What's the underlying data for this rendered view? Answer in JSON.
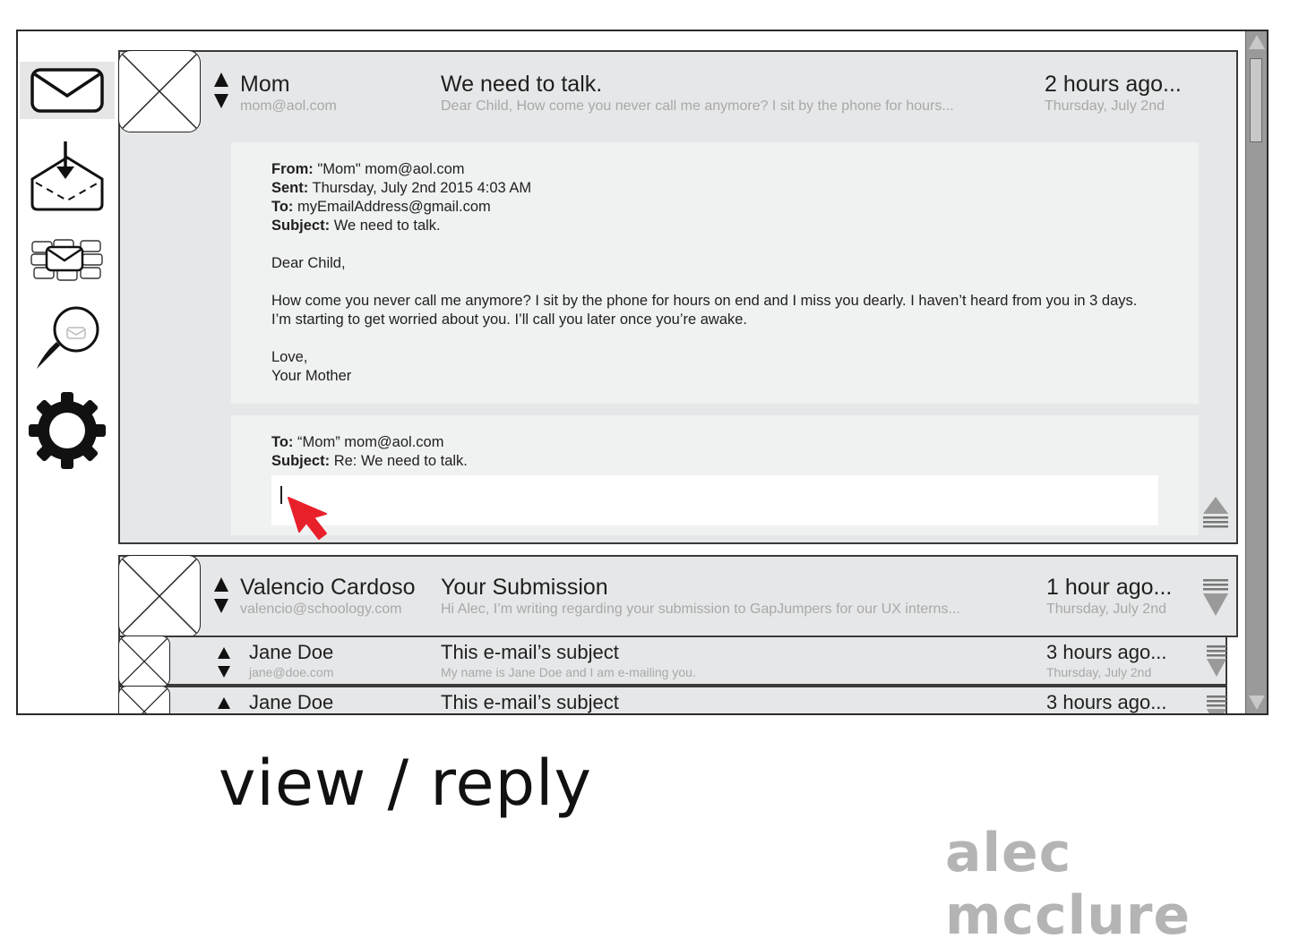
{
  "app": {
    "caption": "view / reply",
    "author": "alec mcclure"
  },
  "sidebar": {
    "items": [
      {
        "icon": "envelope-icon",
        "label": ""
      },
      {
        "icon": "inbox-download-icon",
        "label": ""
      },
      {
        "icon": "mail-stack-icon",
        "label": ""
      },
      {
        "icon": "search-icon",
        "label": ""
      },
      {
        "icon": "gear-icon",
        "label": ""
      }
    ]
  },
  "open_message": {
    "sender": "Mom",
    "email": "mom@aol.com",
    "subject": "We need to talk.",
    "preview": "Dear Child,  How come you never call me anymore?  I sit by the phone for hours...",
    "time": "2 hours ago...",
    "date": "Thursday, July 2nd",
    "headers": {
      "from_label": "From:",
      "from_value": "\"Mom\" mom@aol.com",
      "sent_label": "Sent:",
      "sent_value": "Thursday, July 2nd 2015 4:03 AM",
      "to_label": "To:",
      "to_value": "myEmailAddress@gmail.com",
      "subject_label": "Subject:",
      "subject_value": "We need to talk."
    },
    "body": {
      "greeting": "Dear Child,",
      "paragraph": "How come you never call me anymore?  I sit by the phone for hours on end and I miss you dearly.  I haven’t heard from you in 3 days.  I’m starting to get worried about you.  I’ll call you later once you’re awake.",
      "closing": "Love,",
      "signature": "Your Mother"
    },
    "reply": {
      "to_label": "To:",
      "to_value": "“Mom” mom@aol.com",
      "subject_label": "Subject:",
      "subject_value": "Re: We need to talk.",
      "input_value": ""
    }
  },
  "messages": [
    {
      "sender": "Valencio Cardoso",
      "email": "valencio@schoology.com",
      "subject": "Your Submission",
      "preview": "Hi Alec,  I’m writing regarding your submission to GapJumpers for our UX interns...",
      "time": "1 hour ago...",
      "date": "Thursday, July 2nd"
    },
    {
      "sender": "Jane Doe",
      "email": "jane@doe.com",
      "subject": "This e-mail’s subject",
      "preview": "My name is Jane Doe and I am e-mailing you.",
      "time": "3 hours ago...",
      "date": "Thursday, July 2nd"
    },
    {
      "sender": "Jane Doe",
      "email": "",
      "subject": "This e-mail’s subject",
      "preview": "",
      "time": "3 hours ago...",
      "date": ""
    }
  ],
  "colors": {
    "panel": "#e6e7e8",
    "body": "#f0f1f1",
    "muted_text": "#a8a8a8",
    "cursor": "#e8202a",
    "scrollbar": "#9a9a9a"
  }
}
